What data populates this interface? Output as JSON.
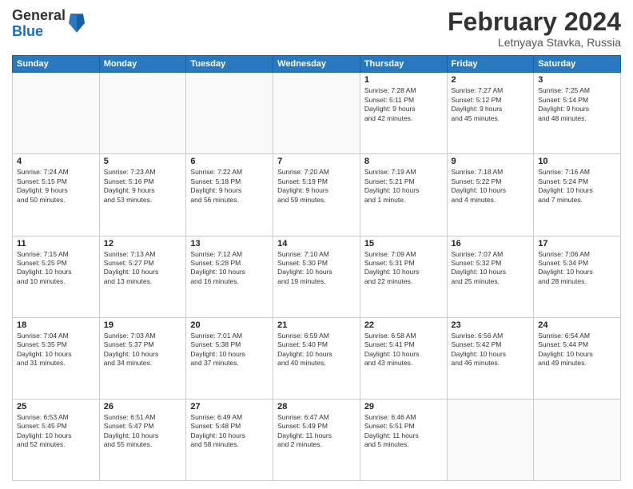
{
  "logo": {
    "general": "General",
    "blue": "Blue"
  },
  "header": {
    "month": "February 2024",
    "location": "Letnyaya Stavka, Russia"
  },
  "weekdays": [
    "Sunday",
    "Monday",
    "Tuesday",
    "Wednesday",
    "Thursday",
    "Friday",
    "Saturday"
  ],
  "weeks": [
    [
      {
        "day": "",
        "info": ""
      },
      {
        "day": "",
        "info": ""
      },
      {
        "day": "",
        "info": ""
      },
      {
        "day": "",
        "info": ""
      },
      {
        "day": "1",
        "info": "Sunrise: 7:28 AM\nSunset: 5:11 PM\nDaylight: 9 hours\nand 42 minutes."
      },
      {
        "day": "2",
        "info": "Sunrise: 7:27 AM\nSunset: 5:12 PM\nDaylight: 9 hours\nand 45 minutes."
      },
      {
        "day": "3",
        "info": "Sunrise: 7:25 AM\nSunset: 5:14 PM\nDaylight: 9 hours\nand 48 minutes."
      }
    ],
    [
      {
        "day": "4",
        "info": "Sunrise: 7:24 AM\nSunset: 5:15 PM\nDaylight: 9 hours\nand 50 minutes."
      },
      {
        "day": "5",
        "info": "Sunrise: 7:23 AM\nSunset: 5:16 PM\nDaylight: 9 hours\nand 53 minutes."
      },
      {
        "day": "6",
        "info": "Sunrise: 7:22 AM\nSunset: 5:18 PM\nDaylight: 9 hours\nand 56 minutes."
      },
      {
        "day": "7",
        "info": "Sunrise: 7:20 AM\nSunset: 5:19 PM\nDaylight: 9 hours\nand 59 minutes."
      },
      {
        "day": "8",
        "info": "Sunrise: 7:19 AM\nSunset: 5:21 PM\nDaylight: 10 hours\nand 1 minute."
      },
      {
        "day": "9",
        "info": "Sunrise: 7:18 AM\nSunset: 5:22 PM\nDaylight: 10 hours\nand 4 minutes."
      },
      {
        "day": "10",
        "info": "Sunrise: 7:16 AM\nSunset: 5:24 PM\nDaylight: 10 hours\nand 7 minutes."
      }
    ],
    [
      {
        "day": "11",
        "info": "Sunrise: 7:15 AM\nSunset: 5:25 PM\nDaylight: 10 hours\nand 10 minutes."
      },
      {
        "day": "12",
        "info": "Sunrise: 7:13 AM\nSunset: 5:27 PM\nDaylight: 10 hours\nand 13 minutes."
      },
      {
        "day": "13",
        "info": "Sunrise: 7:12 AM\nSunset: 5:28 PM\nDaylight: 10 hours\nand 16 minutes."
      },
      {
        "day": "14",
        "info": "Sunrise: 7:10 AM\nSunset: 5:30 PM\nDaylight: 10 hours\nand 19 minutes."
      },
      {
        "day": "15",
        "info": "Sunrise: 7:09 AM\nSunset: 5:31 PM\nDaylight: 10 hours\nand 22 minutes."
      },
      {
        "day": "16",
        "info": "Sunrise: 7:07 AM\nSunset: 5:32 PM\nDaylight: 10 hours\nand 25 minutes."
      },
      {
        "day": "17",
        "info": "Sunrise: 7:06 AM\nSunset: 5:34 PM\nDaylight: 10 hours\nand 28 minutes."
      }
    ],
    [
      {
        "day": "18",
        "info": "Sunrise: 7:04 AM\nSunset: 5:35 PM\nDaylight: 10 hours\nand 31 minutes."
      },
      {
        "day": "19",
        "info": "Sunrise: 7:03 AM\nSunset: 5:37 PM\nDaylight: 10 hours\nand 34 minutes."
      },
      {
        "day": "20",
        "info": "Sunrise: 7:01 AM\nSunset: 5:38 PM\nDaylight: 10 hours\nand 37 minutes."
      },
      {
        "day": "21",
        "info": "Sunrise: 6:59 AM\nSunset: 5:40 PM\nDaylight: 10 hours\nand 40 minutes."
      },
      {
        "day": "22",
        "info": "Sunrise: 6:58 AM\nSunset: 5:41 PM\nDaylight: 10 hours\nand 43 minutes."
      },
      {
        "day": "23",
        "info": "Sunrise: 6:56 AM\nSunset: 5:42 PM\nDaylight: 10 hours\nand 46 minutes."
      },
      {
        "day": "24",
        "info": "Sunrise: 6:54 AM\nSunset: 5:44 PM\nDaylight: 10 hours\nand 49 minutes."
      }
    ],
    [
      {
        "day": "25",
        "info": "Sunrise: 6:53 AM\nSunset: 5:45 PM\nDaylight: 10 hours\nand 52 minutes."
      },
      {
        "day": "26",
        "info": "Sunrise: 6:51 AM\nSunset: 5:47 PM\nDaylight: 10 hours\nand 55 minutes."
      },
      {
        "day": "27",
        "info": "Sunrise: 6:49 AM\nSunset: 5:48 PM\nDaylight: 10 hours\nand 58 minutes."
      },
      {
        "day": "28",
        "info": "Sunrise: 6:47 AM\nSunset: 5:49 PM\nDaylight: 11 hours\nand 2 minutes."
      },
      {
        "day": "29",
        "info": "Sunrise: 6:46 AM\nSunset: 5:51 PM\nDaylight: 11 hours\nand 5 minutes."
      },
      {
        "day": "",
        "info": ""
      },
      {
        "day": "",
        "info": ""
      }
    ]
  ]
}
